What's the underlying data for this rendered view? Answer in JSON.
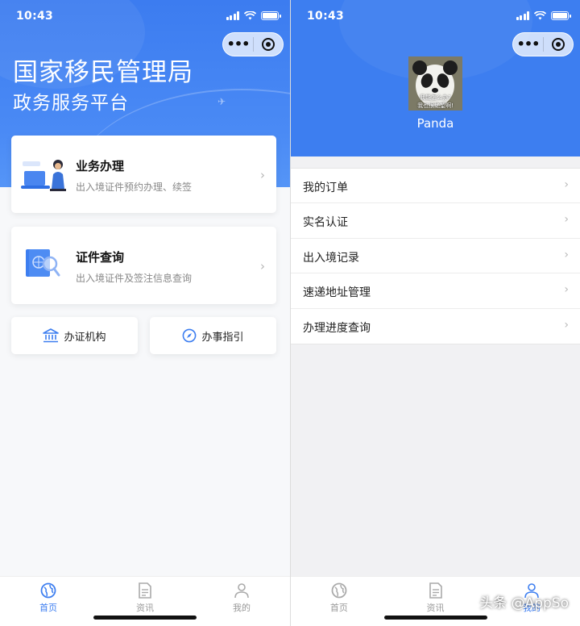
{
  "status_bar": {
    "time": "10:43"
  },
  "left": {
    "title_main": "国家移民管理局",
    "title_sub": "政务服务平台",
    "cards": [
      {
        "title": "业务办理",
        "desc": "出入境证件预约办理、续签"
      },
      {
        "title": "证件查询",
        "desc": "出入境证件及签注信息查询"
      }
    ],
    "buttons": {
      "agency": "办证机构",
      "guide": "办事指引"
    }
  },
  "right": {
    "avatar_caption_1": "我能怎么办?",
    "avatar_caption_2": "我也很绝望啊!",
    "nickname": "Panda",
    "menu": [
      "我的订单",
      "实名认证",
      "出入境记录",
      "速递地址管理",
      "办理进度查询"
    ]
  },
  "tabs": [
    "首页",
    "资讯",
    "我的"
  ],
  "watermark": "头条 @AppSo",
  "colors": {
    "accent": "#3d7ef0",
    "hero": "#4a8af5"
  }
}
